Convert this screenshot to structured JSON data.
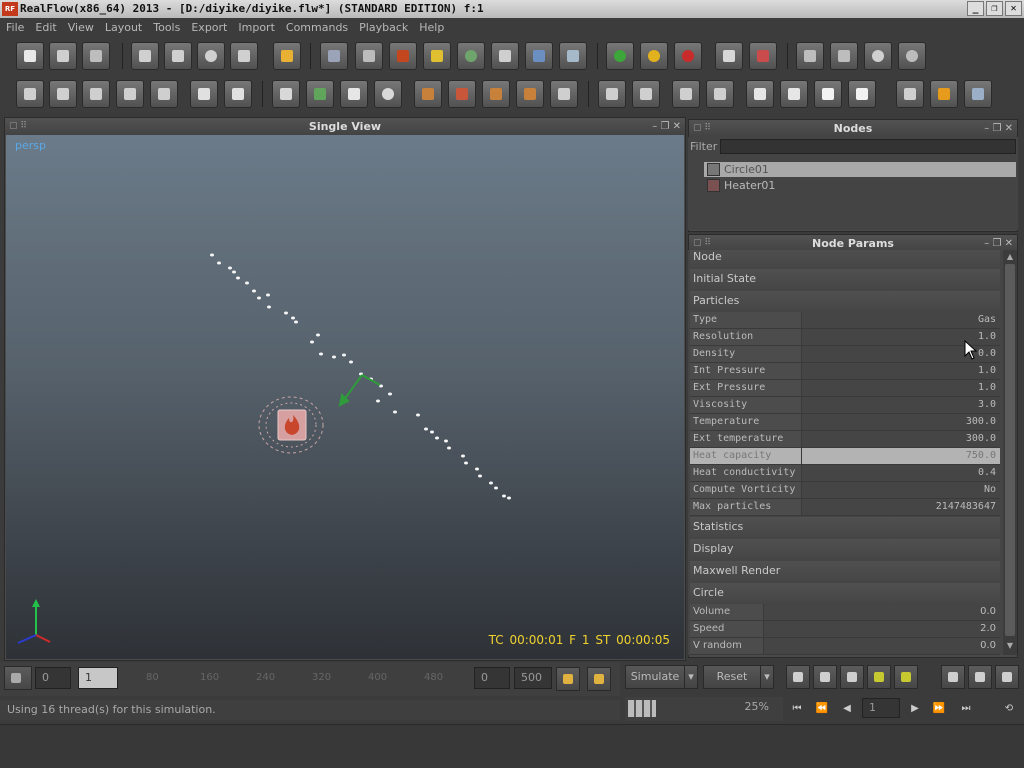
{
  "window": {
    "logo": "RF",
    "title": "RealFlow(x86_64) 2013 - [D:/diyike/diyike.flw*] (STANDARD EDITION) f:1",
    "controls": [
      "_",
      "❐",
      "✕"
    ]
  },
  "menu": [
    "File",
    "Edit",
    "View",
    "Layout",
    "Tools",
    "Export",
    "Import",
    "Commands",
    "Playback",
    "Help"
  ],
  "colors": {
    "accent_blue": "#5aa8e8",
    "hud_yellow": "#f2d22f",
    "selection": "#a9a9a9"
  },
  "viewport": {
    "header": "Single View",
    "camera_label": "persp",
    "hud": "TC 00:00:01   F 1   ST 00:00:05"
  },
  "nodes": {
    "header": "Nodes",
    "filter_label": "Filter",
    "items": [
      {
        "label": "Circle01",
        "icon": "circle-emitter-icon",
        "selected": true
      },
      {
        "label": "Heater01",
        "icon": "heater-daemon-icon",
        "selected": false
      }
    ]
  },
  "params": {
    "header": "Node Params",
    "sections_top": [
      "Node",
      "Initial State",
      "Particles"
    ],
    "rows": [
      {
        "label": "Type",
        "value": "Gas"
      },
      {
        "label": "Resolution",
        "value": "1.0"
      },
      {
        "label": "Density",
        "value": "0.0"
      },
      {
        "label": "Int Pressure",
        "value": "1.0"
      },
      {
        "label": "Ext Pressure",
        "value": "1.0"
      },
      {
        "label": "Viscosity",
        "value": "3.0"
      },
      {
        "label": "Temperature",
        "value": "300.0"
      },
      {
        "label": "Ext temperature",
        "value": "300.0"
      },
      {
        "label": "Heat capacity",
        "value": "750.0"
      },
      {
        "label": "Heat conductivity",
        "value": "0.4"
      },
      {
        "label": "Compute Vorticity",
        "value": "No"
      },
      {
        "label": "Max particles",
        "value": "2147483647"
      }
    ],
    "sections_bottom": [
      "Statistics",
      "Display",
      "Maxwell Render",
      "Circle"
    ],
    "circle_rows": [
      {
        "label": "Volume",
        "value": "0.0"
      },
      {
        "label": "Speed",
        "value": "2.0"
      },
      {
        "label": "V random",
        "value": "0.0"
      }
    ]
  },
  "timeline": {
    "start": "0",
    "current": "1",
    "ticks": [
      "80",
      "160",
      "240",
      "320",
      "400",
      "480"
    ],
    "range_start": "0",
    "range_end": "500"
  },
  "status": "Using 16 thread(s) for this simulation.",
  "sim": {
    "simulate_label": "Simulate",
    "reset_label": "Reset",
    "progress": "25%",
    "frame": "1"
  }
}
